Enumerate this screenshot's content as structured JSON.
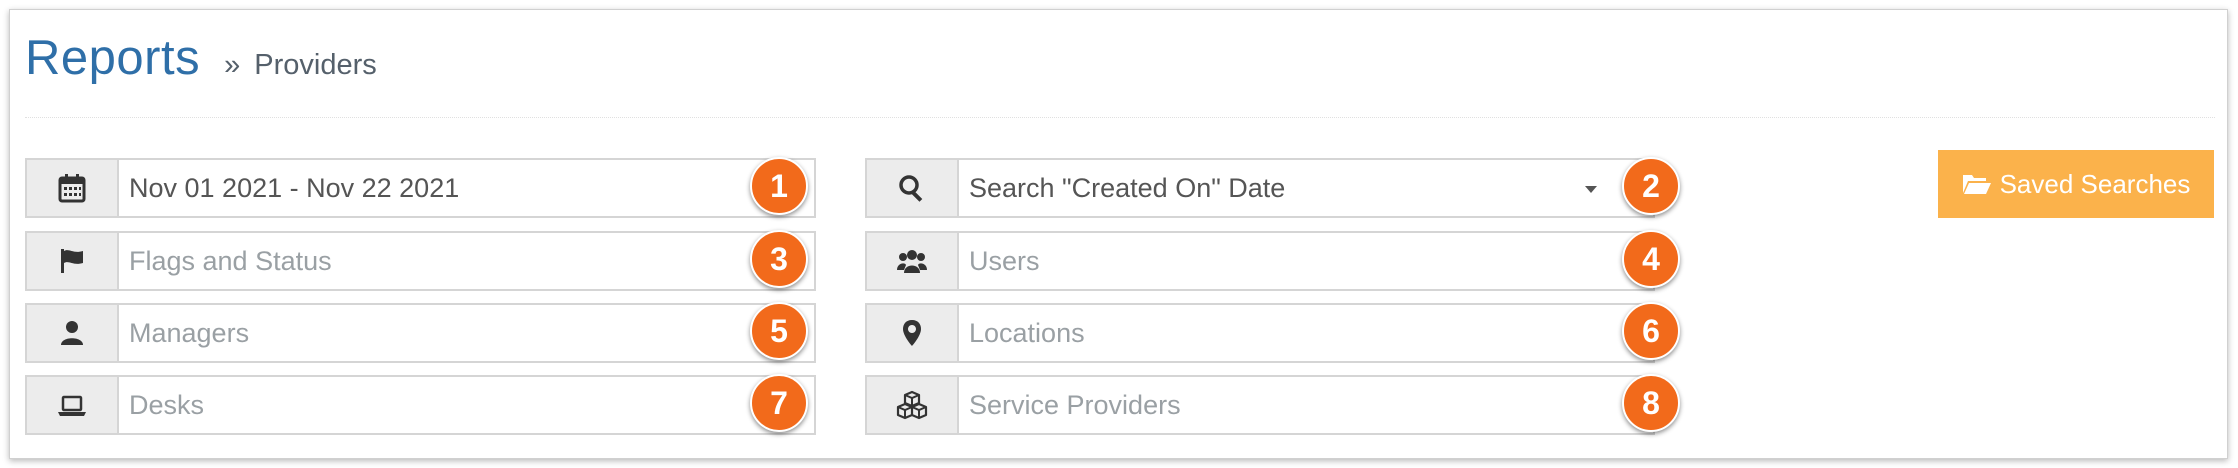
{
  "header": {
    "title": "Reports",
    "breadcrumb_sep": "»",
    "breadcrumb": "Providers"
  },
  "filters": {
    "date_range": {
      "value": "Nov 01 2021 - Nov 22 2021",
      "icon": "calendar-icon",
      "badge": "1"
    },
    "date_type": {
      "value": "Search \"Created On\" Date",
      "icon": "search-icon",
      "badge": "2"
    },
    "flags": {
      "placeholder": "Flags and Status",
      "icon": "flag-icon",
      "badge": "3"
    },
    "users": {
      "placeholder": "Users",
      "icon": "users-icon",
      "badge": "4"
    },
    "managers": {
      "placeholder": "Managers",
      "icon": "user-icon",
      "badge": "5"
    },
    "locations": {
      "placeholder": "Locations",
      "icon": "map-marker-icon",
      "badge": "6"
    },
    "desks": {
      "placeholder": "Desks",
      "icon": "laptop-icon",
      "badge": "7"
    },
    "service_providers": {
      "placeholder": "Service Providers",
      "icon": "cubes-icon",
      "badge": "8"
    }
  },
  "saved_searches": {
    "label": "Saved Searches",
    "icon": "folder-open-icon"
  },
  "colors": {
    "title": "#2f6fa8",
    "badge": "#f26a1b",
    "saved_button": "#fbb24b",
    "icon_bg": "#ececec"
  }
}
